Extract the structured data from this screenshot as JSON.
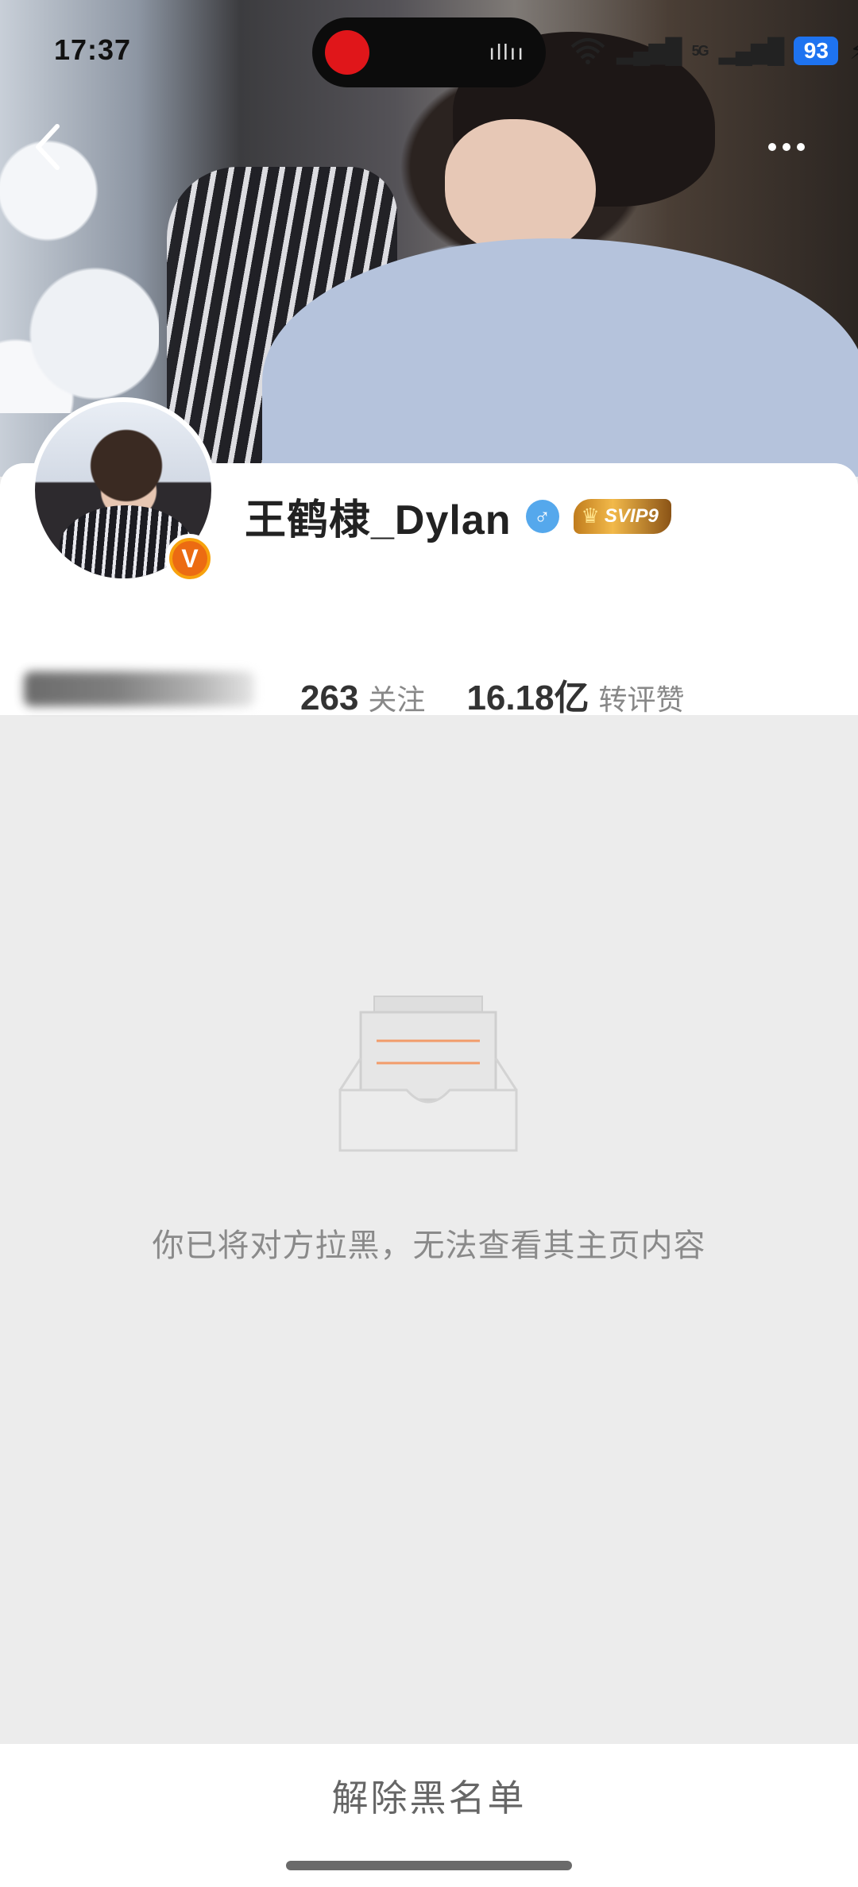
{
  "status_bar": {
    "time": "17:37",
    "battery": "93",
    "network": "5G"
  },
  "header": {
    "back_icon": "chevron-left-icon",
    "more_icon": "more-horizontal-icon"
  },
  "profile": {
    "name": "王鹤棣_Dylan",
    "verified_badge": "V",
    "gender_symbol": "♂",
    "vip_label": "SVIP9",
    "stats": [
      {
        "value": "263",
        "label": "关注"
      },
      {
        "value": "16.18亿",
        "label": "转评赞"
      }
    ]
  },
  "blocked_state": {
    "message": "你已将对方拉黑，无法查看其主页内容",
    "icon": "inbox-tray-icon",
    "accent_color": "#f29c6b"
  },
  "footer": {
    "unblock_label": "解除黑名单"
  }
}
